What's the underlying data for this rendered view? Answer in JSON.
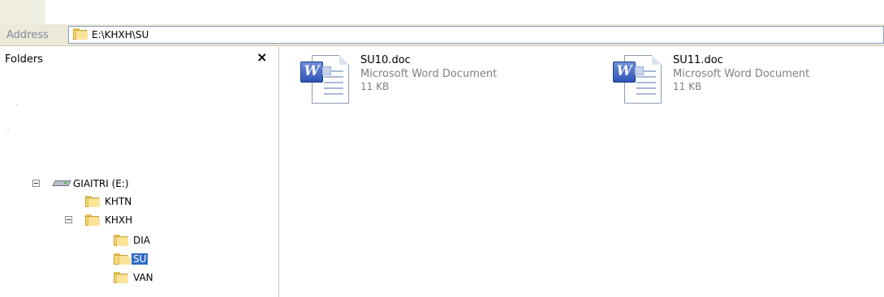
{
  "address": {
    "label": "Address",
    "path": "E:\\KHXH\\SU"
  },
  "folders_pane": {
    "title": "Folders",
    "close_symbol": "×",
    "tree": {
      "drive": {
        "label": "GIAITRI (E:)",
        "icon": "drive-icon",
        "expanded": true
      },
      "items": [
        {
          "label": "KHTN",
          "icon": "folder-icon"
        },
        {
          "label": "KHXH",
          "icon": "folder-icon",
          "expanded": true,
          "children": [
            {
              "label": "DIA",
              "icon": "folder-icon"
            },
            {
              "label": "SU",
              "icon": "folder-open-icon",
              "selected": true
            },
            {
              "label": "VAN",
              "icon": "folder-icon"
            }
          ]
        }
      ]
    }
  },
  "files": [
    {
      "name": "SU10.doc",
      "type": "Microsoft Word Document",
      "size": "11 KB",
      "icon": "word-document-icon"
    },
    {
      "name": "SU11.doc",
      "type": "Microsoft Word Document",
      "size": "11 KB",
      "icon": "word-document-icon"
    }
  ],
  "colors": {
    "selection": "#316ac5",
    "toolbar_bg": "#ece9d8",
    "address_border": "#7f9db9",
    "secondary_text": "#808080"
  }
}
